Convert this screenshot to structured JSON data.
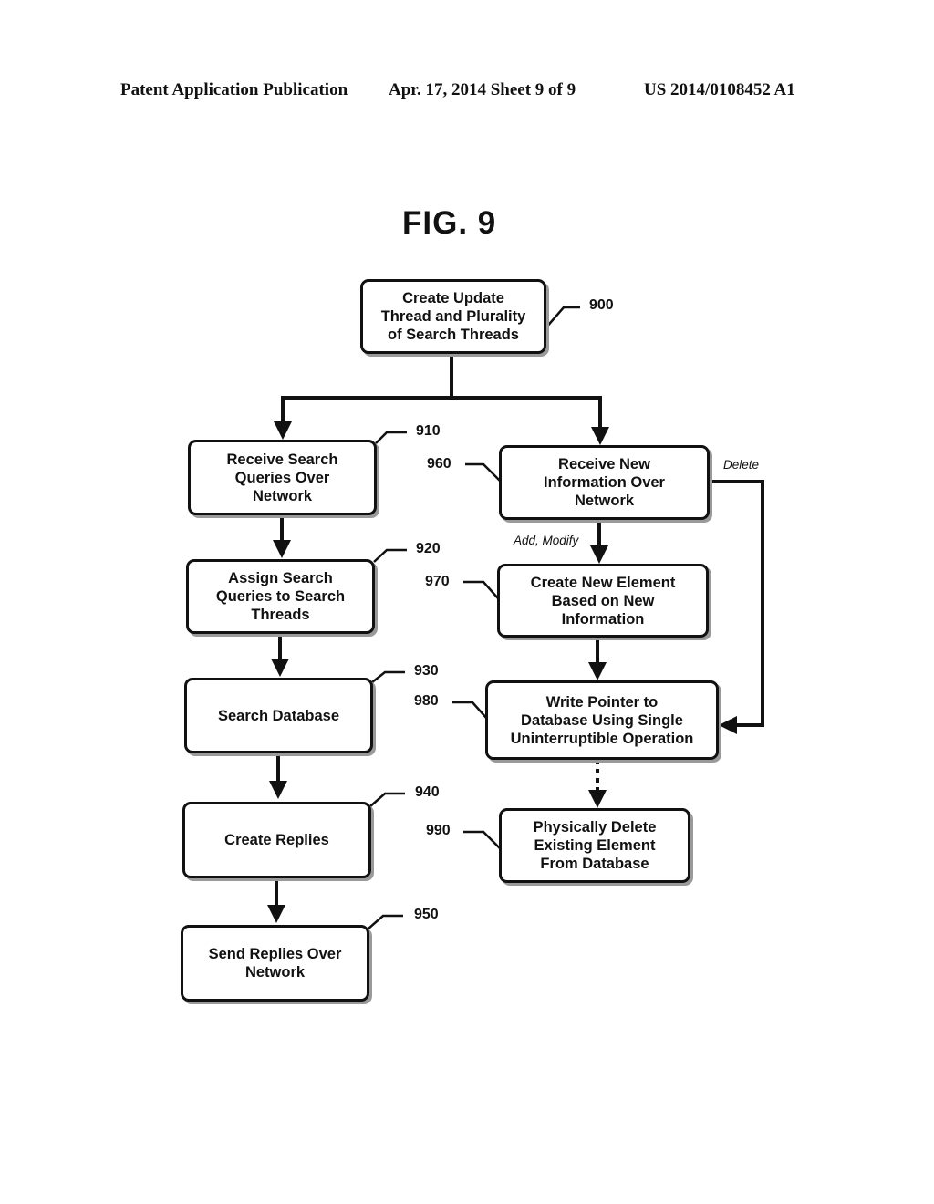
{
  "header": {
    "publication": "Patent Application Publication",
    "date_sheet": "Apr. 17, 2014  Sheet 9 of 9",
    "patent_number": "US 2014/0108452 A1"
  },
  "figure": {
    "title": "FIG. 9"
  },
  "steps": {
    "s900": {
      "ref": "900",
      "text": "Create Update\nThread and Plurality\nof Search Threads"
    },
    "s910": {
      "ref": "910",
      "text": "Receive Search\nQueries Over\nNetwork"
    },
    "s920": {
      "ref": "920",
      "text": "Assign Search\nQueries to Search\nThreads"
    },
    "s930": {
      "ref": "930",
      "text": "Search Database"
    },
    "s940": {
      "ref": "940",
      "text": "Create Replies"
    },
    "s950": {
      "ref": "950",
      "text": "Send Replies Over\nNetwork"
    },
    "s960": {
      "ref": "960",
      "text": "Receive New\nInformation Over\nNetwork"
    },
    "s970": {
      "ref": "970",
      "text": "Create New Element\nBased on New\nInformation"
    },
    "s980": {
      "ref": "980",
      "text": "Write Pointer to\nDatabase Using Single\nUninterruptible Operation"
    },
    "s990": {
      "ref": "990",
      "text": "Physically Delete\nExisting Element\nFrom Database"
    }
  },
  "edge_labels": {
    "add_modify": "Add, Modify",
    "delete": "Delete"
  }
}
